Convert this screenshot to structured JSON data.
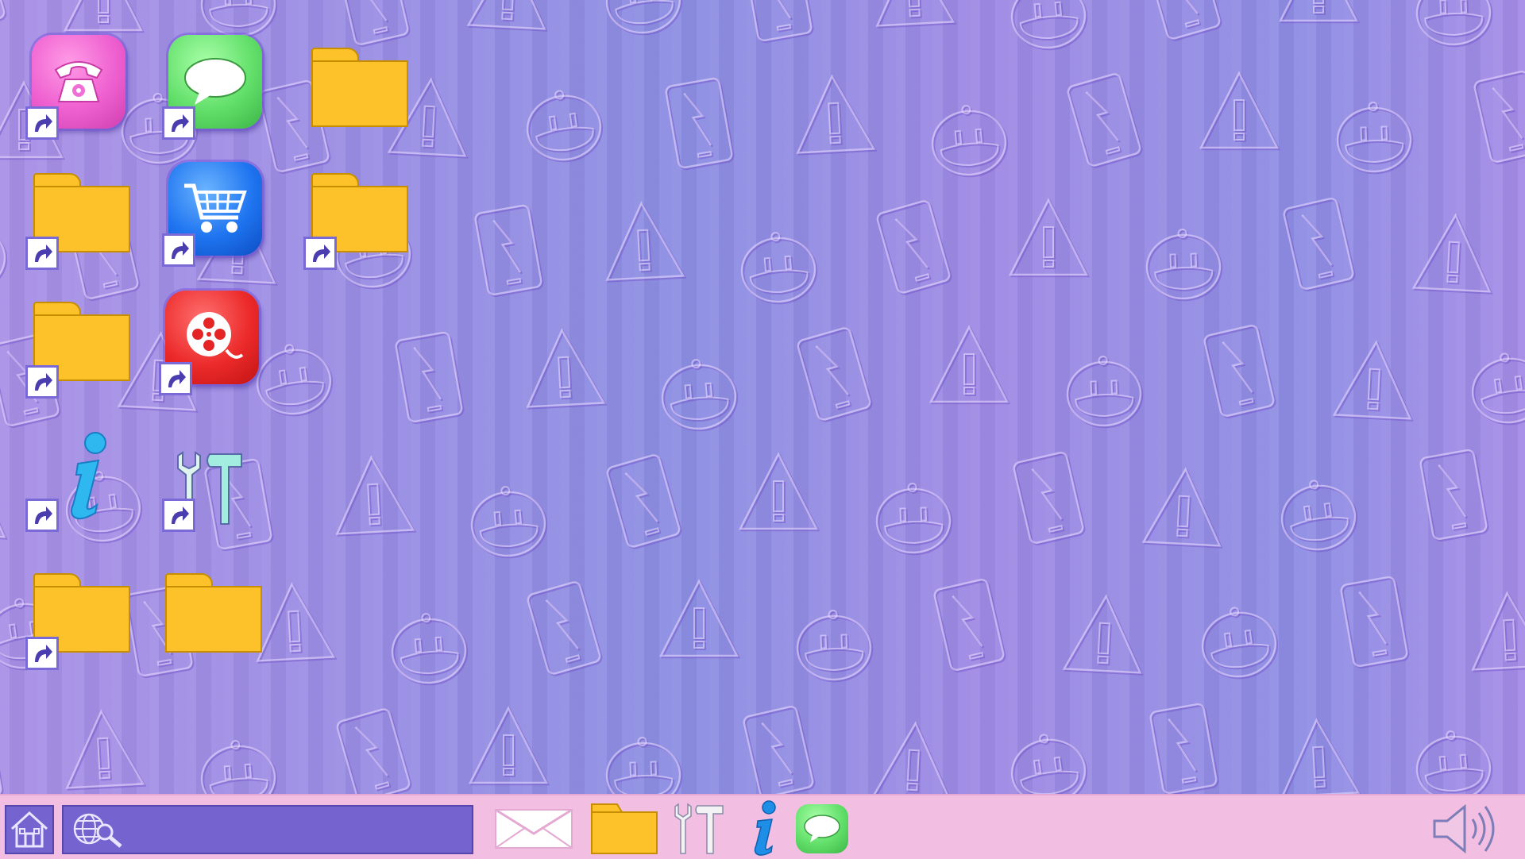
{
  "desktop": {
    "icons": [
      {
        "name": "phone-app-shortcut",
        "type": "app",
        "glyph": "phone-icon",
        "color": "#ee5fcf",
        "shortcut": true
      },
      {
        "name": "messages-app-shortcut",
        "type": "app",
        "glyph": "chat-bubble-icon",
        "color": "#62df6a",
        "shortcut": true
      },
      {
        "name": "folder",
        "type": "folder",
        "shortcut": false
      },
      {
        "name": "folder-shortcut",
        "type": "folder",
        "shortcut": true
      },
      {
        "name": "shopping-app-shortcut",
        "type": "app",
        "glyph": "shopping-cart-icon",
        "color": "#1f74f0",
        "shortcut": true
      },
      {
        "name": "folder-shortcut",
        "type": "folder",
        "shortcut": true
      },
      {
        "name": "folder-shortcut",
        "type": "folder",
        "shortcut": true
      },
      {
        "name": "video-app-shortcut",
        "type": "app",
        "glyph": "film-reel-icon",
        "color": "#ec2a2a",
        "shortcut": true
      },
      {
        "name": "info-app-shortcut",
        "type": "app",
        "glyph": "info-icon",
        "shortcut": true
      },
      {
        "name": "tools-app-shortcut",
        "type": "app",
        "glyph": "wrench-hammer-icon",
        "shortcut": true
      },
      {
        "name": "folder-shortcut",
        "type": "folder",
        "shortcut": true
      },
      {
        "name": "folder",
        "type": "folder",
        "shortcut": false
      }
    ]
  },
  "taskbar": {
    "home_icon": "home-icon",
    "search": {
      "icon": "globe-search-icon",
      "value": "",
      "placeholder": ""
    },
    "pinned": [
      "mail-icon",
      "folder-icon",
      "tools-icon",
      "info-icon",
      "chat-bubble-icon"
    ],
    "volume_icon": "speaker-icon"
  },
  "colors": {
    "wallpaper": "#9a8ee4",
    "taskbar": "#f2bfe2",
    "search_box": "#7563cf",
    "folder": "#fdc22a",
    "accent_outline": "#7a6ad8"
  }
}
